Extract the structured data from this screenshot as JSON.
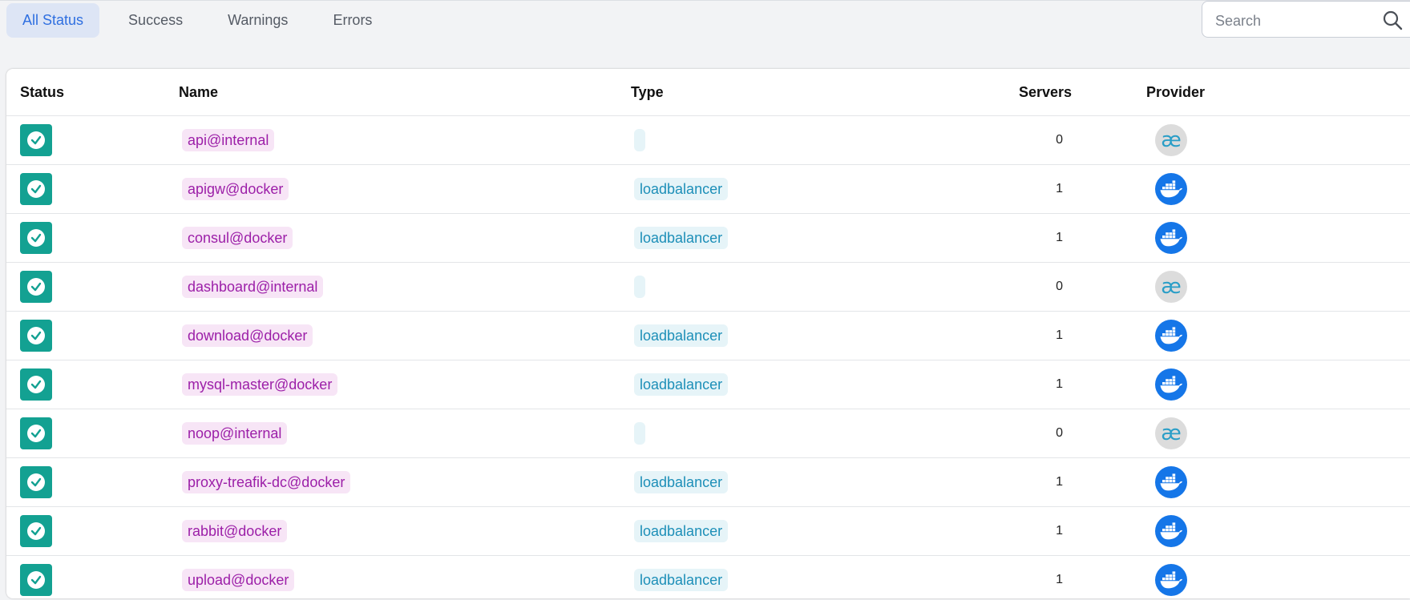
{
  "filters": {
    "all": "All Status",
    "success": "Success",
    "warnings": "Warnings",
    "errors": "Errors"
  },
  "search": {
    "placeholder": "Search"
  },
  "table": {
    "headers": {
      "status": "Status",
      "name": "Name",
      "type": "Type",
      "servers": "Servers",
      "provider": "Provider"
    },
    "rows": [
      {
        "status": "success",
        "name": "api@internal",
        "type": "",
        "servers": "0",
        "provider": "internal",
        "provider_glyph": "æ"
      },
      {
        "status": "success",
        "name": "apigw@docker",
        "type": "loadbalancer",
        "servers": "1",
        "provider": "docker",
        "provider_glyph": ""
      },
      {
        "status": "success",
        "name": "consul@docker",
        "type": "loadbalancer",
        "servers": "1",
        "provider": "docker",
        "provider_glyph": ""
      },
      {
        "status": "success",
        "name": "dashboard@internal",
        "type": "",
        "servers": "0",
        "provider": "internal",
        "provider_glyph": "æ"
      },
      {
        "status": "success",
        "name": "download@docker",
        "type": "loadbalancer",
        "servers": "1",
        "provider": "docker",
        "provider_glyph": ""
      },
      {
        "status": "success",
        "name": "mysql-master@docker",
        "type": "loadbalancer",
        "servers": "1",
        "provider": "docker",
        "provider_glyph": ""
      },
      {
        "status": "success",
        "name": "noop@internal",
        "type": "",
        "servers": "0",
        "provider": "internal",
        "provider_glyph": "æ"
      },
      {
        "status": "success",
        "name": "proxy-treafik-dc@docker",
        "type": "loadbalancer",
        "servers": "1",
        "provider": "docker",
        "provider_glyph": ""
      },
      {
        "status": "success",
        "name": "rabbit@docker",
        "type": "loadbalancer",
        "servers": "1",
        "provider": "docker",
        "provider_glyph": ""
      },
      {
        "status": "success",
        "name": "upload@docker",
        "type": "loadbalancer",
        "servers": "1",
        "provider": "docker",
        "provider_glyph": ""
      }
    ]
  },
  "colors": {
    "success": "#13a192",
    "active_tab_bg": "#dde5f5",
    "active_tab_text": "#2f6fe0",
    "name_chip_bg": "#f7e5f6",
    "name_chip_text": "#9c1fa8",
    "type_chip_bg": "#e6f4f8",
    "type_chip_text": "#1d8fb8",
    "docker_blue": "#1576e8"
  },
  "icons": {
    "status": "check-circle-icon",
    "search": "search-icon",
    "docker": "docker-whale-icon",
    "internal": "traefik-internal-icon"
  }
}
